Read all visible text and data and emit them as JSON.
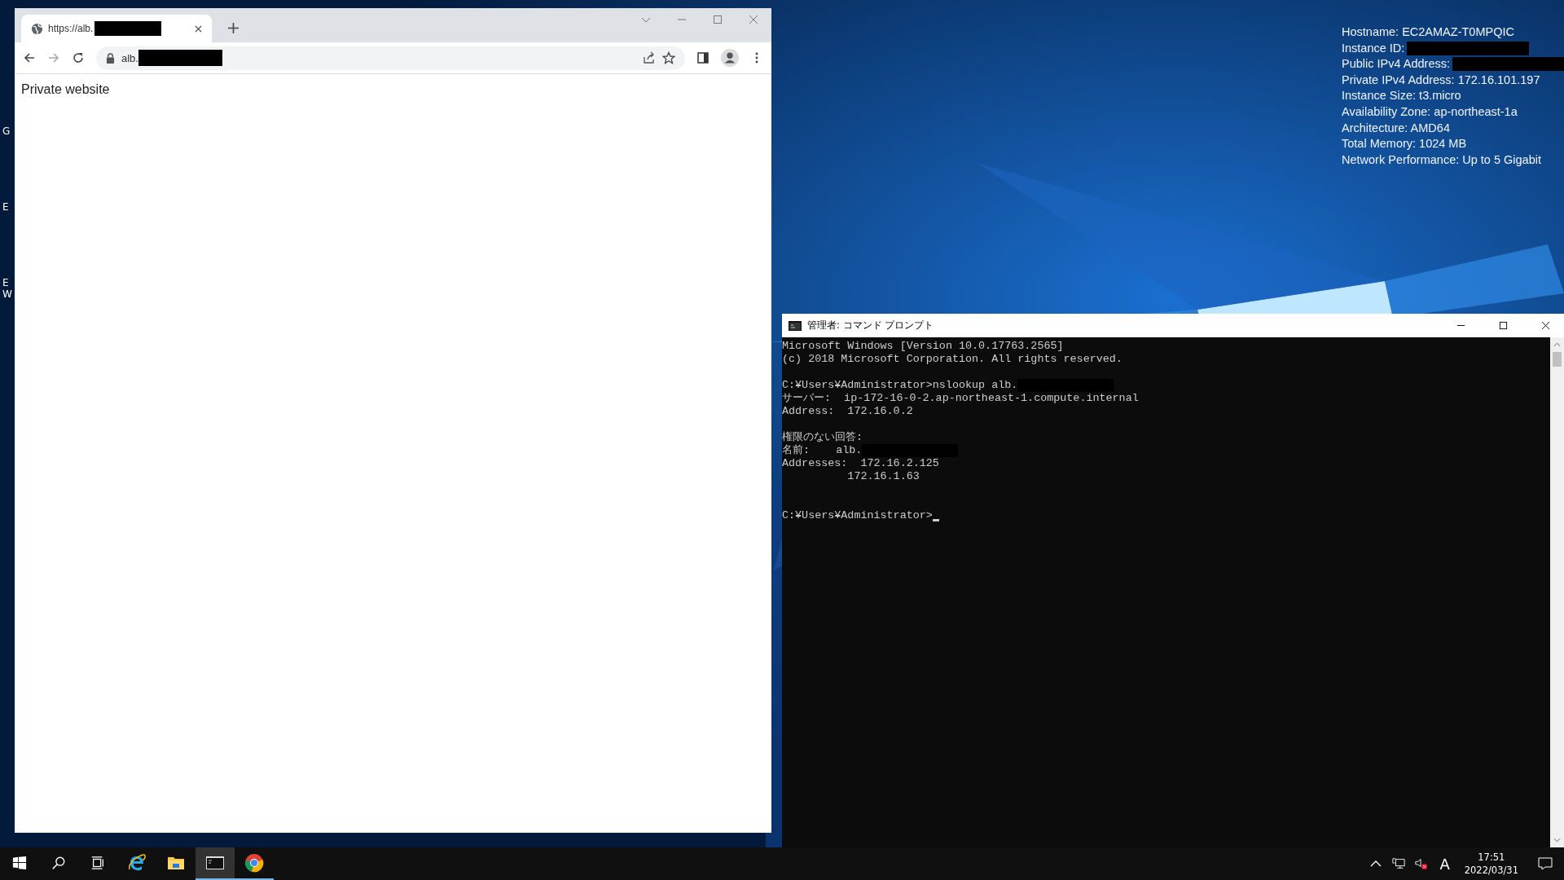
{
  "desktop": {
    "icon_fragments": [
      "G",
      "E",
      "E\nW"
    ]
  },
  "system_info": [
    {
      "text": "Hostname: EC2AMAZ-T0MPQIC",
      "redacted": false
    },
    {
      "text": "Instance ID:",
      "redacted": true
    },
    {
      "text": "Public IPv4 Address:",
      "redacted": true
    },
    {
      "text": "Private IPv4 Address: 172.16.101.197",
      "redacted": false
    },
    {
      "text": "Instance Size: t3.micro",
      "redacted": false
    },
    {
      "text": "Availability Zone: ap-northeast-1a",
      "redacted": false
    },
    {
      "text": "Architecture: AMD64",
      "redacted": false
    },
    {
      "text": "Total Memory: 1024 MB",
      "redacted": false
    },
    {
      "text": "Network Performance: Up to 5 Gigabit",
      "redacted": false
    }
  ],
  "browser": {
    "tab": {
      "title": "https://alb.",
      "redacted": true,
      "selected": true
    },
    "address": {
      "value": "alb.",
      "redacted": true
    },
    "page_text": "Private website"
  },
  "command_prompt": {
    "title": "管理者: コマンド プロンプト",
    "lines": [
      {
        "kind": "text",
        "text": "Microsoft Windows [Version 10.0.17763.2565]",
        "redacted": false
      },
      {
        "kind": "text",
        "text": "(c) 2018 Microsoft Corporation. All rights reserved.",
        "redacted": false
      },
      {
        "kind": "blank"
      },
      {
        "kind": "text",
        "text": "C:¥Users¥Administrator>nslookup alb.",
        "redacted": true
      },
      {
        "kind": "text",
        "text": "サーバー:  ip-172-16-0-2.ap-northeast-1.compute.internal",
        "redacted": false
      },
      {
        "kind": "text",
        "text": "Address:  172.16.0.2",
        "redacted": false
      },
      {
        "kind": "blank"
      },
      {
        "kind": "text",
        "text": "権限のない回答:",
        "redacted": false
      },
      {
        "kind": "text",
        "text": "名前:    alb.",
        "redacted": true
      },
      {
        "kind": "text",
        "text": "Addresses:  172.16.2.125",
        "redacted": false
      },
      {
        "kind": "text",
        "text": "          172.16.1.63",
        "redacted": false
      },
      {
        "kind": "blank"
      },
      {
        "kind": "blank"
      },
      {
        "kind": "input",
        "text": "C:¥Users¥Administrator>"
      }
    ]
  },
  "taskbar": {
    "apps": [
      {
        "kind": "start",
        "selected": false
      },
      {
        "kind": "search",
        "selected": false
      },
      {
        "kind": "taskview",
        "selected": false
      },
      {
        "kind": "ie",
        "selected": false
      },
      {
        "kind": "explorer",
        "selected": false
      },
      {
        "kind": "cmd",
        "selected": true
      },
      {
        "kind": "chrome",
        "selected": false
      }
    ],
    "tray": {
      "input_indicator": "A",
      "time": "17:51",
      "date": "2022/03/31"
    }
  }
}
